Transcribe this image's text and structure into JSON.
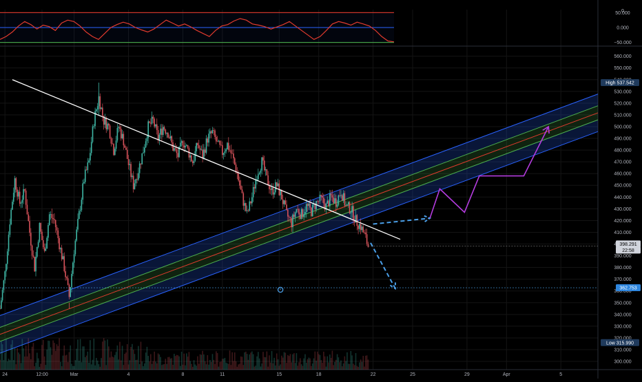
{
  "chart_data": [
    {
      "type": "line",
      "panel": "oscillator",
      "ylim": [
        -60,
        60
      ],
      "y_ticks": [
        "50.000",
        "0.000",
        "−50.000"
      ],
      "pane_label": "0",
      "levels": {
        "upper": 50,
        "middle": 0,
        "lower": -50
      },
      "series_color": "#e33b2e",
      "series": [
        {
          "x": [
            0,
            3,
            6,
            9,
            12,
            15,
            18,
            21,
            24,
            27,
            30,
            33,
            36,
            39,
            42,
            45,
            48,
            51,
            54,
            57,
            60,
            63,
            66,
            69,
            72,
            75,
            78,
            81,
            84,
            87,
            90,
            93,
            96,
            99,
            102,
            105,
            108,
            111,
            114,
            117,
            120,
            123,
            126,
            129,
            132,
            135,
            138,
            141,
            144,
            147,
            150,
            153,
            156,
            159,
            162,
            165,
            168,
            171,
            174,
            177,
            180,
            183,
            186,
            189,
            192
          ],
          "values": [
            -40,
            -30,
            -15,
            5,
            20,
            10,
            -5,
            8,
            3,
            -10,
            15,
            25,
            20,
            5,
            -15,
            -30,
            -40,
            -20,
            0,
            10,
            18,
            12,
            0,
            -8,
            -15,
            -5,
            10,
            25,
            15,
            5,
            12,
            2,
            -10,
            -20,
            -30,
            -10,
            5,
            10,
            22,
            30,
            25,
            12,
            8,
            3,
            -5,
            2,
            10,
            20,
            5,
            -10,
            -25,
            -40,
            -30,
            -10,
            12,
            20,
            15,
            8,
            18,
            12,
            5,
            -10,
            -30,
            -45,
            -48
          ]
        }
      ]
    },
    {
      "type": "candlestick",
      "panel": "price",
      "ylim": [
        293,
        568
      ],
      "y_ticks": [
        "560.000",
        "550.000",
        "540.000",
        "530.000",
        "520.000",
        "510.000",
        "500.000",
        "490.000",
        "480.000",
        "470.000",
        "460.000",
        "450.000",
        "440.000",
        "430.000",
        "420.000",
        "410.000",
        "400.000",
        "390.000",
        "380.000",
        "370.000",
        "360.000",
        "350.000",
        "340.000",
        "330.000",
        "320.000",
        "310.000",
        "300.000"
      ],
      "x_ticks": [
        {
          "label": "24",
          "x": 2
        },
        {
          "label": "12:00",
          "x": 17
        },
        {
          "label": "Mar",
          "x": 30
        },
        {
          "label": "4",
          "x": 52
        },
        {
          "label": "8",
          "x": 74
        },
        {
          "label": "11",
          "x": 90
        },
        {
          "label": "15",
          "x": 113
        },
        {
          "label": "18",
          "x": 129
        },
        {
          "label": "22",
          "x": 151
        },
        {
          "label": "25",
          "x": 167
        },
        {
          "label": "29",
          "x": 189
        },
        {
          "label": "Apr",
          "x": 205
        },
        {
          "label": "5",
          "x": 227
        }
      ],
      "xlim": [
        0,
        242
      ],
      "close_path": [
        [
          0,
          345
        ],
        [
          2,
          375
        ],
        [
          4,
          420
        ],
        [
          6,
          455
        ],
        [
          8,
          435
        ],
        [
          10,
          445
        ],
        [
          12,
          410
        ],
        [
          14,
          380
        ],
        [
          16,
          415
        ],
        [
          18,
          392
        ],
        [
          20,
          425
        ],
        [
          22,
          420
        ],
        [
          24,
          400
        ],
        [
          26,
          380
        ],
        [
          28,
          355
        ],
        [
          30,
          395
        ],
        [
          32,
          425
        ],
        [
          34,
          455
        ],
        [
          36,
          470
        ],
        [
          38,
          505
        ],
        [
          40,
          525
        ],
        [
          42,
          505
        ],
        [
          44,
          500
        ],
        [
          46,
          480
        ],
        [
          48,
          500
        ],
        [
          50,
          488
        ],
        [
          52,
          468
        ],
        [
          54,
          450
        ],
        [
          56,
          463
        ],
        [
          58,
          480
        ],
        [
          60,
          500
        ],
        [
          62,
          505
        ],
        [
          64,
          490
        ],
        [
          66,
          500
        ],
        [
          68,
          495
        ],
        [
          70,
          482
        ],
        [
          72,
          475
        ],
        [
          74,
          488
        ],
        [
          76,
          480
        ],
        [
          78,
          470
        ],
        [
          80,
          485
        ],
        [
          82,
          475
        ],
        [
          84,
          490
        ],
        [
          86,
          495
        ],
        [
          88,
          485
        ],
        [
          90,
          478
        ],
        [
          92,
          485
        ],
        [
          94,
          475
        ],
        [
          96,
          460
        ],
        [
          98,
          440
        ],
        [
          100,
          425
        ],
        [
          102,
          440
        ],
        [
          104,
          460
        ],
        [
          106,
          470
        ],
        [
          108,
          455
        ],
        [
          110,
          445
        ],
        [
          112,
          450
        ],
        [
          114,
          440
        ],
        [
          116,
          425
        ],
        [
          118,
          418
        ],
        [
          120,
          430
        ],
        [
          122,
          425
        ],
        [
          124,
          432
        ],
        [
          126,
          428
        ],
        [
          128,
          435
        ],
        [
          130,
          438
        ],
        [
          132,
          432
        ],
        [
          134,
          440
        ],
        [
          136,
          436
        ],
        [
          138,
          445
        ],
        [
          140,
          432
        ],
        [
          142,
          430
        ],
        [
          144,
          420
        ],
        [
          146,
          415
        ],
        [
          148,
          405
        ],
        [
          149,
          398.291
        ]
      ],
      "high": 537.542,
      "low": 315.99,
      "last": 398.291,
      "countdown": "22:58",
      "marked_level": 362.753,
      "bull_color": "#3fb7a6",
      "bear_color": "#d7525a"
    }
  ],
  "price_tags": {
    "high_label": "High",
    "high_value": "537.542",
    "low_label": "Low",
    "low_value": "315.990",
    "last_value": "398.291",
    "countdown": "22:58",
    "level_value": "362.753"
  },
  "drawings": {
    "trendline": {
      "x": [
        5,
        162
      ],
      "y": [
        540,
        404
      ]
    },
    "channel": {
      "start_x": 0,
      "end_x": 242,
      "center_start": 323,
      "slope": 0.78,
      "upper_offset": 16,
      "inner_offset": 6,
      "outer_color": "#2962ff",
      "inner_color": "#4caf50",
      "center_color": "#e33b2e"
    },
    "projection_blue": {
      "color": "#4a9fe8",
      "segments": [
        [
          [
            150,
            401
          ],
          [
            160,
            362
          ]
        ],
        [
          [
            151,
            417
          ],
          [
            174,
            422
          ]
        ]
      ]
    },
    "projection_purple": {
      "color": "#b43cdf",
      "points": [
        [
          174,
          422
        ],
        [
          178,
          447
        ],
        [
          188,
          427
        ],
        [
          194,
          458
        ],
        [
          212,
          458
        ],
        [
          222,
          500
        ]
      ]
    }
  }
}
